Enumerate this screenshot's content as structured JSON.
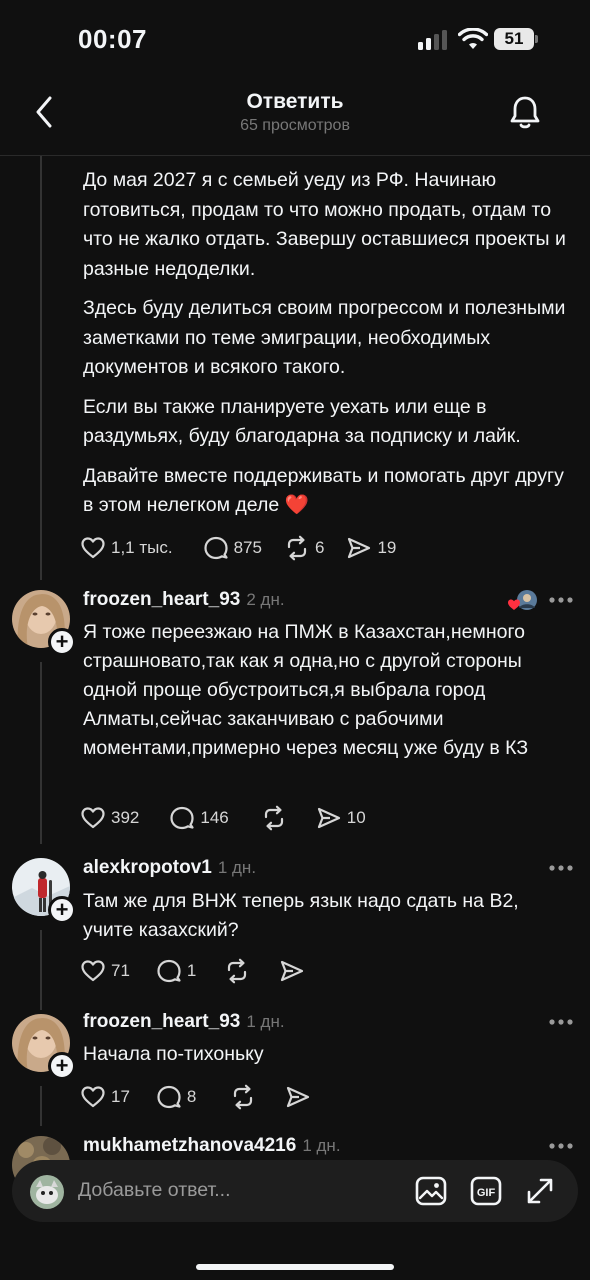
{
  "status_bar": {
    "time": "00:07",
    "battery": "51"
  },
  "header": {
    "title": "Ответить",
    "subtitle": "65 просмотров"
  },
  "post": {
    "paragraphs": [
      "До мая 2027 я с семьей уеду из РФ. Начинаю готовиться, продам то что можно продать, отдам то что не жалко отдать. Завершу оставшиеся проекты и разные недоделки.",
      "Здесь буду делиться своим прогрессом и полезными заметками по теме эмиграции, необходимых документов и всякого такого.",
      "Если вы также планируете уехать или еще в раздумьях, буду благодарна за подписку и лайк.",
      "Давайте вместе поддерживать и помогать друг другу в этом нелегком деле"
    ],
    "heart_emoji": "❤️",
    "likes": "1,1 тыс.",
    "comments": "875",
    "reposts": "6",
    "shares": "19"
  },
  "replies": [
    {
      "username": "froozen_heart_93",
      "ago": "2 дн.",
      "text": "Я тоже переезжаю на ПМЖ в Казахстан,немного страшновато,так как я одна,но с другой стороны одной проще обустроиться,я выбрала город Алматы,сейчас заканчиваю с рабочими моментами,примерно через месяц уже буду в КЗ",
      "likes": "392",
      "comments": "146",
      "reposts": "",
      "shares": "10"
    },
    {
      "username": "alexkropotov1",
      "ago": "1 дн.",
      "text": "Там же для ВНЖ теперь язык надо сдать на В2, учите казахский?",
      "likes": "71",
      "comments": "1",
      "reposts": "",
      "shares": ""
    },
    {
      "username": "froozen_heart_93",
      "ago": "1 дн.",
      "text": "Начала по-тихоньку",
      "likes": "17",
      "comments": "8",
      "reposts": "",
      "shares": ""
    },
    {
      "username": "mukhametzhanova4216",
      "ago": "1 дн.",
      "text": ""
    }
  ],
  "compose": {
    "placeholder": "Добавьте ответ..."
  },
  "colors": {
    "background": "#101010",
    "text": "#f3f5f7",
    "muted": "#777777",
    "heart": "#e0245e"
  }
}
